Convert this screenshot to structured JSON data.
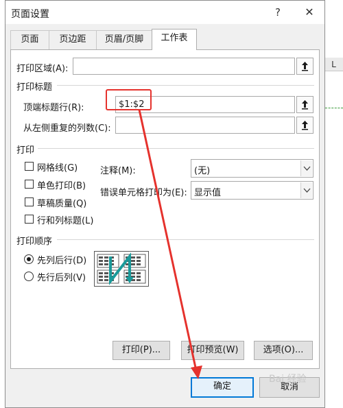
{
  "dialog": {
    "title": "页面设置",
    "help_label": "?",
    "close_label": "✕"
  },
  "background": {
    "column_label": "L"
  },
  "tabs": [
    {
      "label": "页面",
      "active": false
    },
    {
      "label": "页边距",
      "active": false
    },
    {
      "label": "页眉/页脚",
      "active": false
    },
    {
      "label": "工作表",
      "active": true
    }
  ],
  "print_area": {
    "label": "打印区域(A):",
    "value": ""
  },
  "print_titles": {
    "section": "打印标题",
    "top_rows_label": "顶端标题行(R):",
    "top_rows_value": "$1:$2",
    "left_cols_label": "从左侧重复的列数(C):",
    "left_cols_value": ""
  },
  "print": {
    "section": "打印",
    "gridlines": {
      "label": "网格线(G)",
      "checked": false
    },
    "black_white": {
      "label": "单色打印(B)",
      "checked": false
    },
    "draft": {
      "label": "草稿质量(Q)",
      "checked": false
    },
    "row_col_headings": {
      "label": "行和列标题(L)",
      "checked": false
    },
    "comments_label": "注释(M):",
    "comments_value": "(无)",
    "errors_label": "错误单元格打印为(E):",
    "errors_value": "显示值"
  },
  "page_order": {
    "section": "打印顺序",
    "down_then_over": {
      "label": "先列后行(D)",
      "selected": true
    },
    "over_then_down": {
      "label": "先行后列(V)",
      "selected": false
    }
  },
  "buttons": {
    "print": "打印(P)...",
    "print_preview": "打印预览(W)",
    "options": "选项(O)...",
    "ok": "确定",
    "cancel": "取消"
  },
  "watermark": "Bai 经验",
  "colors": {
    "accent": "#0078d7",
    "annotation": "#e5322d",
    "dialog_bg": "#f0f0f0",
    "page_order_teal": "#1a9a9a"
  }
}
